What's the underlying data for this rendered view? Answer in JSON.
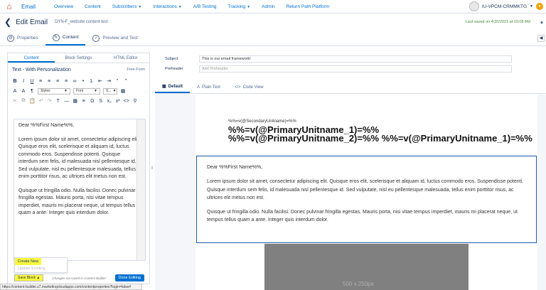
{
  "topnav": {
    "app": "Email",
    "items": [
      {
        "label": "Overview",
        "caret": false
      },
      {
        "label": "Content",
        "caret": false
      },
      {
        "label": "Subscribers",
        "caret": true
      },
      {
        "label": "Interactions",
        "caret": true
      },
      {
        "label": "A/B Testing",
        "caret": false
      },
      {
        "label": "Tracking",
        "caret": true
      },
      {
        "label": "Admin",
        "caret": false
      },
      {
        "label": "Return Path Platform",
        "caret": false
      }
    ],
    "account": "IU-VPCM-CRMMKTG"
  },
  "header": {
    "title": "Edit Email",
    "email_name": "DYN-F_website content test",
    "saved": "Last saved on 4/20/2021 at 10:08 AM"
  },
  "tabs": [
    {
      "label": "Properties"
    },
    {
      "label": "Content"
    },
    {
      "label": "Preview and Test"
    }
  ],
  "left": {
    "subtabs": [
      "Content",
      "Block Settings",
      "HTML Editor"
    ],
    "block_title": "Text - With Personalization",
    "block_mode": "Free Form",
    "styles_label": "Styles",
    "font_label": "Font",
    "size_label": "S...",
    "editor_paragraphs": [
      "Dear %%First Name%%,",
      "Lorem ipsum dolor sit amet, consectetur adipiscing elit. Quisque eros elit, scelerisque et aliquam id, luctus commodo eros. Suspendisse potenti. Quisque interdum sem felis, id malesuada nisl pellentesque id. Sed vulputate, nisl eu pellentesque malesuada, tellus enim porttitor risus, ac ultrices elit metus non est.",
      "Quisque ut fringilla odio. Nulla facilisi. Donec pulvinar fringilla egestas. Mauris porta, nisi vitae tempus imperdiet, mauris mi placerat neque, ut tempus tellus quam a ante. Integer quis interdum dolor."
    ],
    "dropup": {
      "create_new": "Create New",
      "update": "Update Existing"
    },
    "save_block": "Save Block",
    "unsaved": "Changes not saved in Content Builder",
    "done": "Done Editing"
  },
  "status_url": "https://content-builder.s7.marketingcloudapps.com/contentproperties?login=false#",
  "right": {
    "subject_label": "Subject",
    "subject_value": "This is our email framework!",
    "preheader_label": "Preheader",
    "preheader_placeholder": "Add Preheader",
    "tabs": [
      "Default",
      "Plain Text",
      "Code View"
    ],
    "secondary": "%%=v(@SecondaryUnitname)=%%",
    "primary1": "%%=v(@PrimaryUnitname_1)=%%",
    "primary2": "%%=v(@PrimaryUnitname_2)=%% %%=v(@PrimaryUnitname_1)=%%",
    "body": [
      "Dear %%First Name%%,",
      "Lorem ipsum dolor sit amet, consectetur adipiscing elit. Quisque eros elit, scelerisque et aliquam id, luctus commodo eros. Suspendisse potenti. Quisque interdum sem felis, id malesuada nisl pellentesque id. Sed vulputate, nisl eu pellentesque malesuada, tellus enim porttitor risus, ac ultrices elit metus non est.",
      "Quisque ut fringilla odio. Nulla facilisi. Donec pulvinar fringilla egestas. Mauris porta, nisi vitae tempus imperdiet, mauris mi placerat neque, ut tempus tellus quam a ante. Integer quis interdum dolor."
    ],
    "image_placeholder": "500 x 250px"
  },
  "colors": {
    "brand_blue": "#0070d2",
    "highlight": "#f7f740",
    "saved_green": "#4b8a3e"
  }
}
